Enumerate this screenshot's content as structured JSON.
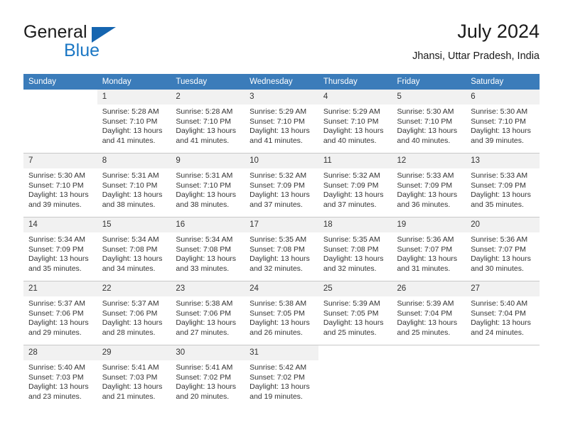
{
  "brand": {
    "word_one": "General",
    "word_two": "Blue",
    "triangle_color": "#1565b0",
    "blue_color": "#1b77c4"
  },
  "header": {
    "title": "July 2024",
    "subtitle": "Jhansi, Uttar Pradesh, India"
  },
  "theme": {
    "header_bg": "#3b7cba",
    "daynum_bg": "#f1f1f1",
    "grid_line": "#c8c8c8",
    "text": "#333333"
  },
  "weekday_headers": [
    "Sunday",
    "Monday",
    "Tuesday",
    "Wednesday",
    "Thursday",
    "Friday",
    "Saturday"
  ],
  "labels": {
    "sunrise_prefix": "Sunrise:",
    "sunset_prefix": "Sunset:",
    "daylight_prefix": "Daylight:"
  },
  "weeks": [
    [
      {
        "day": "",
        "empty": true,
        "sunrise": "",
        "sunset": "",
        "daylight_line1": "",
        "daylight_line2": ""
      },
      {
        "day": "1",
        "empty": false,
        "sunrise": "Sunrise: 5:28 AM",
        "sunset": "Sunset: 7:10 PM",
        "daylight_line1": "Daylight: 13 hours",
        "daylight_line2": "and 41 minutes."
      },
      {
        "day": "2",
        "empty": false,
        "sunrise": "Sunrise: 5:28 AM",
        "sunset": "Sunset: 7:10 PM",
        "daylight_line1": "Daylight: 13 hours",
        "daylight_line2": "and 41 minutes."
      },
      {
        "day": "3",
        "empty": false,
        "sunrise": "Sunrise: 5:29 AM",
        "sunset": "Sunset: 7:10 PM",
        "daylight_line1": "Daylight: 13 hours",
        "daylight_line2": "and 41 minutes."
      },
      {
        "day": "4",
        "empty": false,
        "sunrise": "Sunrise: 5:29 AM",
        "sunset": "Sunset: 7:10 PM",
        "daylight_line1": "Daylight: 13 hours",
        "daylight_line2": "and 40 minutes."
      },
      {
        "day": "5",
        "empty": false,
        "sunrise": "Sunrise: 5:30 AM",
        "sunset": "Sunset: 7:10 PM",
        "daylight_line1": "Daylight: 13 hours",
        "daylight_line2": "and 40 minutes."
      },
      {
        "day": "6",
        "empty": false,
        "sunrise": "Sunrise: 5:30 AM",
        "sunset": "Sunset: 7:10 PM",
        "daylight_line1": "Daylight: 13 hours",
        "daylight_line2": "and 39 minutes."
      }
    ],
    [
      {
        "day": "7",
        "empty": false,
        "sunrise": "Sunrise: 5:30 AM",
        "sunset": "Sunset: 7:10 PM",
        "daylight_line1": "Daylight: 13 hours",
        "daylight_line2": "and 39 minutes."
      },
      {
        "day": "8",
        "empty": false,
        "sunrise": "Sunrise: 5:31 AM",
        "sunset": "Sunset: 7:10 PM",
        "daylight_line1": "Daylight: 13 hours",
        "daylight_line2": "and 38 minutes."
      },
      {
        "day": "9",
        "empty": false,
        "sunrise": "Sunrise: 5:31 AM",
        "sunset": "Sunset: 7:10 PM",
        "daylight_line1": "Daylight: 13 hours",
        "daylight_line2": "and 38 minutes."
      },
      {
        "day": "10",
        "empty": false,
        "sunrise": "Sunrise: 5:32 AM",
        "sunset": "Sunset: 7:09 PM",
        "daylight_line1": "Daylight: 13 hours",
        "daylight_line2": "and 37 minutes."
      },
      {
        "day": "11",
        "empty": false,
        "sunrise": "Sunrise: 5:32 AM",
        "sunset": "Sunset: 7:09 PM",
        "daylight_line1": "Daylight: 13 hours",
        "daylight_line2": "and 37 minutes."
      },
      {
        "day": "12",
        "empty": false,
        "sunrise": "Sunrise: 5:33 AM",
        "sunset": "Sunset: 7:09 PM",
        "daylight_line1": "Daylight: 13 hours",
        "daylight_line2": "and 36 minutes."
      },
      {
        "day": "13",
        "empty": false,
        "sunrise": "Sunrise: 5:33 AM",
        "sunset": "Sunset: 7:09 PM",
        "daylight_line1": "Daylight: 13 hours",
        "daylight_line2": "and 35 minutes."
      }
    ],
    [
      {
        "day": "14",
        "empty": false,
        "sunrise": "Sunrise: 5:34 AM",
        "sunset": "Sunset: 7:09 PM",
        "daylight_line1": "Daylight: 13 hours",
        "daylight_line2": "and 35 minutes."
      },
      {
        "day": "15",
        "empty": false,
        "sunrise": "Sunrise: 5:34 AM",
        "sunset": "Sunset: 7:08 PM",
        "daylight_line1": "Daylight: 13 hours",
        "daylight_line2": "and 34 minutes."
      },
      {
        "day": "16",
        "empty": false,
        "sunrise": "Sunrise: 5:34 AM",
        "sunset": "Sunset: 7:08 PM",
        "daylight_line1": "Daylight: 13 hours",
        "daylight_line2": "and 33 minutes."
      },
      {
        "day": "17",
        "empty": false,
        "sunrise": "Sunrise: 5:35 AM",
        "sunset": "Sunset: 7:08 PM",
        "daylight_line1": "Daylight: 13 hours",
        "daylight_line2": "and 32 minutes."
      },
      {
        "day": "18",
        "empty": false,
        "sunrise": "Sunrise: 5:35 AM",
        "sunset": "Sunset: 7:08 PM",
        "daylight_line1": "Daylight: 13 hours",
        "daylight_line2": "and 32 minutes."
      },
      {
        "day": "19",
        "empty": false,
        "sunrise": "Sunrise: 5:36 AM",
        "sunset": "Sunset: 7:07 PM",
        "daylight_line1": "Daylight: 13 hours",
        "daylight_line2": "and 31 minutes."
      },
      {
        "day": "20",
        "empty": false,
        "sunrise": "Sunrise: 5:36 AM",
        "sunset": "Sunset: 7:07 PM",
        "daylight_line1": "Daylight: 13 hours",
        "daylight_line2": "and 30 minutes."
      }
    ],
    [
      {
        "day": "21",
        "empty": false,
        "sunrise": "Sunrise: 5:37 AM",
        "sunset": "Sunset: 7:06 PM",
        "daylight_line1": "Daylight: 13 hours",
        "daylight_line2": "and 29 minutes."
      },
      {
        "day": "22",
        "empty": false,
        "sunrise": "Sunrise: 5:37 AM",
        "sunset": "Sunset: 7:06 PM",
        "daylight_line1": "Daylight: 13 hours",
        "daylight_line2": "and 28 minutes."
      },
      {
        "day": "23",
        "empty": false,
        "sunrise": "Sunrise: 5:38 AM",
        "sunset": "Sunset: 7:06 PM",
        "daylight_line1": "Daylight: 13 hours",
        "daylight_line2": "and 27 minutes."
      },
      {
        "day": "24",
        "empty": false,
        "sunrise": "Sunrise: 5:38 AM",
        "sunset": "Sunset: 7:05 PM",
        "daylight_line1": "Daylight: 13 hours",
        "daylight_line2": "and 26 minutes."
      },
      {
        "day": "25",
        "empty": false,
        "sunrise": "Sunrise: 5:39 AM",
        "sunset": "Sunset: 7:05 PM",
        "daylight_line1": "Daylight: 13 hours",
        "daylight_line2": "and 25 minutes."
      },
      {
        "day": "26",
        "empty": false,
        "sunrise": "Sunrise: 5:39 AM",
        "sunset": "Sunset: 7:04 PM",
        "daylight_line1": "Daylight: 13 hours",
        "daylight_line2": "and 25 minutes."
      },
      {
        "day": "27",
        "empty": false,
        "sunrise": "Sunrise: 5:40 AM",
        "sunset": "Sunset: 7:04 PM",
        "daylight_line1": "Daylight: 13 hours",
        "daylight_line2": "and 24 minutes."
      }
    ],
    [
      {
        "day": "28",
        "empty": false,
        "sunrise": "Sunrise: 5:40 AM",
        "sunset": "Sunset: 7:03 PM",
        "daylight_line1": "Daylight: 13 hours",
        "daylight_line2": "and 23 minutes."
      },
      {
        "day": "29",
        "empty": false,
        "sunrise": "Sunrise: 5:41 AM",
        "sunset": "Sunset: 7:03 PM",
        "daylight_line1": "Daylight: 13 hours",
        "daylight_line2": "and 21 minutes."
      },
      {
        "day": "30",
        "empty": false,
        "sunrise": "Sunrise: 5:41 AM",
        "sunset": "Sunset: 7:02 PM",
        "daylight_line1": "Daylight: 13 hours",
        "daylight_line2": "and 20 minutes."
      },
      {
        "day": "31",
        "empty": false,
        "sunrise": "Sunrise: 5:42 AM",
        "sunset": "Sunset: 7:02 PM",
        "daylight_line1": "Daylight: 13 hours",
        "daylight_line2": "and 19 minutes."
      },
      {
        "day": "",
        "empty": true,
        "sunrise": "",
        "sunset": "",
        "daylight_line1": "",
        "daylight_line2": ""
      },
      {
        "day": "",
        "empty": true,
        "sunrise": "",
        "sunset": "",
        "daylight_line1": "",
        "daylight_line2": ""
      },
      {
        "day": "",
        "empty": true,
        "sunrise": "",
        "sunset": "",
        "daylight_line1": "",
        "daylight_line2": ""
      }
    ]
  ]
}
